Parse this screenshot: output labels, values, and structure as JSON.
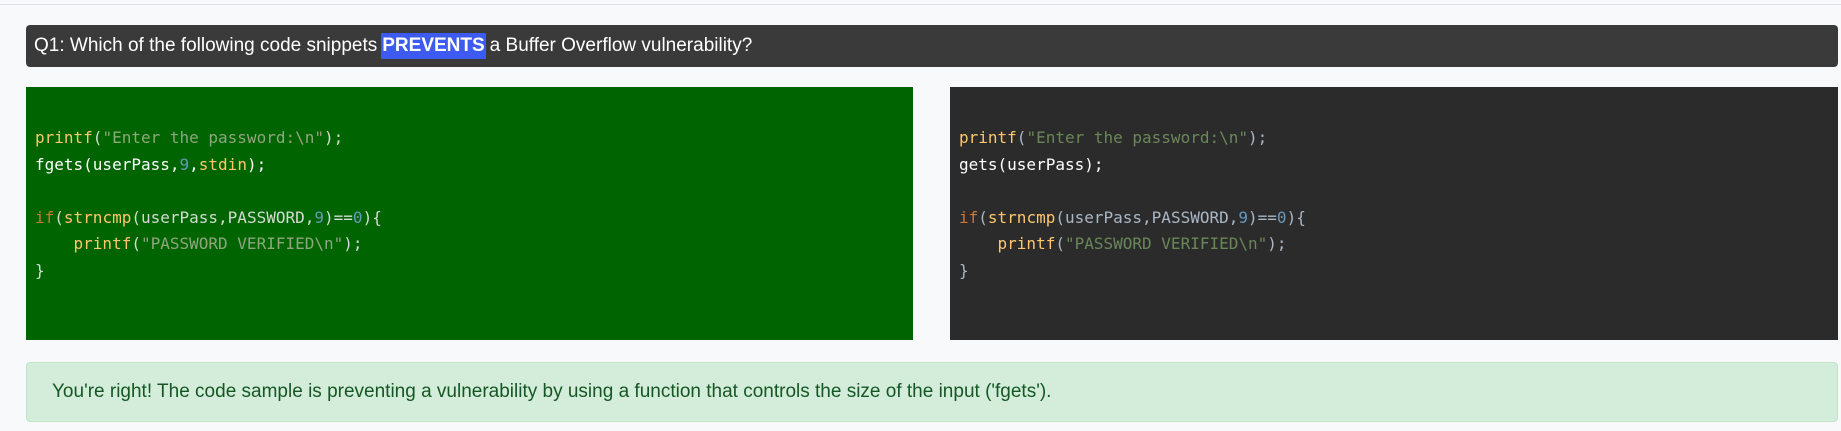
{
  "question": {
    "prefix": "Q1: Which of the following code snippets",
    "highlight": "PREVENTS",
    "suffix": "a Buffer Overflow vulnerability?"
  },
  "options": [
    {
      "selected": true,
      "color": "#006400",
      "lines": [
        [
          {
            "t": "printf",
            "c": "fn"
          },
          {
            "t": "(",
            "c": "txt"
          },
          {
            "t": "\"Enter the password:\\n\"",
            "c": "str"
          },
          {
            "t": ");",
            "c": "txt"
          }
        ],
        [
          {
            "t": "fgets(userPass,",
            "c": "plain"
          },
          {
            "t": "9",
            "c": "num"
          },
          {
            "t": ",",
            "c": "plain"
          },
          {
            "t": "stdin",
            "c": "fn"
          },
          {
            "t": ");",
            "c": "plain"
          }
        ],
        [],
        [
          {
            "t": "if",
            "c": "kw"
          },
          {
            "t": "(",
            "c": "txt"
          },
          {
            "t": "strncmp",
            "c": "fn"
          },
          {
            "t": "(userPass,PASSWORD,",
            "c": "txt"
          },
          {
            "t": "9",
            "c": "num"
          },
          {
            "t": ")==",
            "c": "txt"
          },
          {
            "t": "0",
            "c": "num"
          },
          {
            "t": "){",
            "c": "txt"
          }
        ],
        [
          {
            "t": "    ",
            "c": "txt"
          },
          {
            "t": "printf",
            "c": "fn"
          },
          {
            "t": "(",
            "c": "txt"
          },
          {
            "t": "\"PASSWORD VERIFIED\\n\"",
            "c": "str"
          },
          {
            "t": ");",
            "c": "txt"
          }
        ],
        [
          {
            "t": "}",
            "c": "txt"
          }
        ]
      ]
    },
    {
      "selected": false,
      "color": "#2b2b2b",
      "lines": [
        [
          {
            "t": "printf",
            "c": "fn"
          },
          {
            "t": "(",
            "c": "txt"
          },
          {
            "t": "\"Enter the password:\\n\"",
            "c": "str"
          },
          {
            "t": ");",
            "c": "txt"
          }
        ],
        [
          {
            "t": "gets(userPass);",
            "c": "plain"
          }
        ],
        [],
        [
          {
            "t": "if",
            "c": "kw"
          },
          {
            "t": "(",
            "c": "txt"
          },
          {
            "t": "strncmp",
            "c": "fn"
          },
          {
            "t": "(userPass,PASSWORD,",
            "c": "txt"
          },
          {
            "t": "9",
            "c": "num"
          },
          {
            "t": ")==",
            "c": "txt"
          },
          {
            "t": "0",
            "c": "num"
          },
          {
            "t": "){",
            "c": "txt"
          }
        ],
        [
          {
            "t": "    ",
            "c": "txt"
          },
          {
            "t": "printf",
            "c": "fn"
          },
          {
            "t": "(",
            "c": "txt"
          },
          {
            "t": "\"PASSWORD VERIFIED\\n\"",
            "c": "str"
          },
          {
            "t": ");",
            "c": "txt"
          }
        ],
        [
          {
            "t": "}",
            "c": "txt"
          }
        ]
      ]
    }
  ],
  "feedback": {
    "text": "You're right! The code sample is preventing a vulnerability by using a function that controls the size of the input ('fgets').",
    "color": "#d4edda"
  },
  "colors": {
    "highlight": "#3d5af1",
    "question_bg": "#3a3a3a"
  }
}
